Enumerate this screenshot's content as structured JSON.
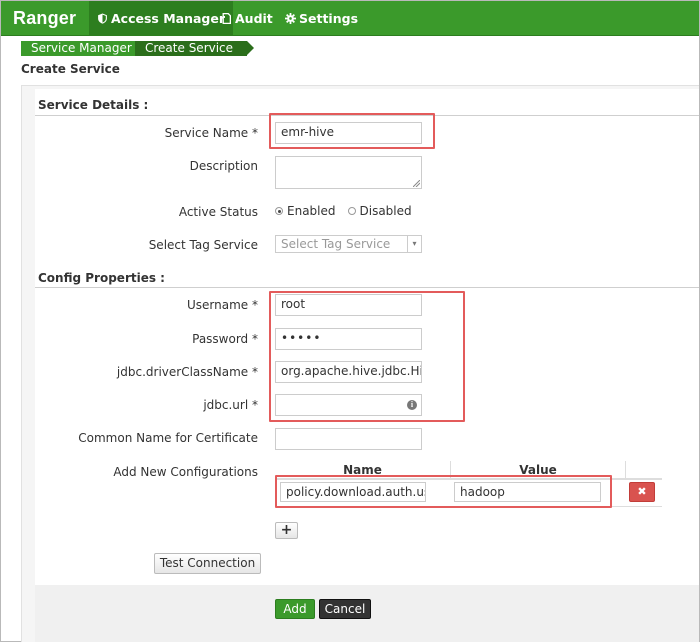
{
  "navbar": {
    "brand": "Ranger",
    "items": [
      {
        "label": "Access Manager",
        "icon": "shield-icon"
      },
      {
        "label": "Audit",
        "icon": "file-icon"
      },
      {
        "label": "Settings",
        "icon": "gear-icon"
      }
    ]
  },
  "breadcrumb": [
    "Service Manager",
    "Create Service"
  ],
  "page_title": "Create Service",
  "service_details": {
    "section_title": "Service Details :",
    "service_name_label": "Service Name *",
    "service_name_value": "emr-hive",
    "description_label": "Description",
    "description_value": "",
    "active_status_label": "Active Status",
    "active_status_options": [
      "Enabled",
      "Disabled"
    ],
    "active_status_selected": "Enabled",
    "tag_service_label": "Select Tag Service",
    "tag_service_placeholder": "Select Tag Service"
  },
  "config_properties": {
    "section_title": "Config Properties :",
    "username_label": "Username *",
    "username_value": "root",
    "password_label": "Password *",
    "password_value": "•••••",
    "driver_label": "jdbc.driverClassName *",
    "driver_value": "org.apache.hive.jdbc.Hiv",
    "url_label": "jdbc.url *",
    "url_value": "",
    "common_name_label": "Common Name for Certificate",
    "common_name_value": "",
    "add_config_label": "Add New Configurations",
    "table_headers": {
      "name": "Name",
      "value": "Value"
    },
    "rows": [
      {
        "name": "policy.download.auth.use",
        "value": "hadoop"
      }
    ]
  },
  "buttons": {
    "plus": "+",
    "test_connection": "Test Connection",
    "add": "Add",
    "cancel": "Cancel",
    "delete": "✖"
  },
  "colors": {
    "brand_green": "#3b9a2b",
    "highlight_red": "#e35b5b",
    "danger": "#d9534f"
  }
}
